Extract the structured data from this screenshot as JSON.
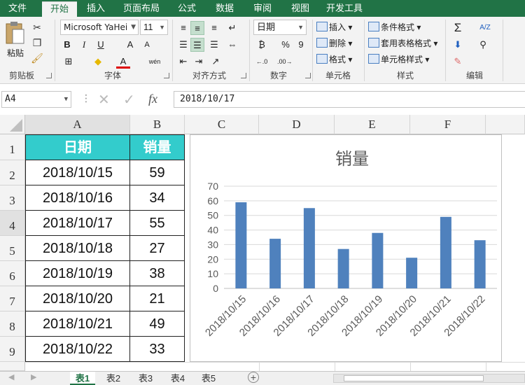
{
  "tabs": [
    "文件",
    "开始",
    "插入",
    "页面布局",
    "公式",
    "数据",
    "审阅",
    "视图",
    "开发工具"
  ],
  "active_tab": "开始",
  "ribbon": {
    "clipboard": {
      "paste": "粘贴",
      "label": "剪贴板"
    },
    "font": {
      "family": "Microsoft YaHei",
      "size": "11",
      "bold": "B",
      "italic": "I",
      "underline": "U",
      "grow": "A",
      "shrink": "A",
      "phonetic": "wén",
      "label": "字体"
    },
    "alignment": {
      "label": "对齐方式"
    },
    "number": {
      "format": "日期",
      "percent": "%",
      "comma": "9",
      "label": "数字"
    },
    "cells": {
      "insert": "插入",
      "delete": "删除",
      "format": "格式",
      "label": "单元格"
    },
    "styles": {
      "conditional": "条件格式",
      "table": "套用表格格式",
      "cell_styles": "单元格样式",
      "label": "样式"
    },
    "editing": {
      "sum": "Σ",
      "sort": "A/Z",
      "label": "编辑"
    }
  },
  "formula_bar": {
    "name_box": "A4",
    "fx": "fx",
    "value": "2018/10/17"
  },
  "columns": [
    "A",
    "B",
    "C",
    "D",
    "E",
    "F"
  ],
  "rows": [
    "1",
    "2",
    "3",
    "4",
    "5",
    "6",
    "7",
    "8",
    "9"
  ],
  "table": {
    "header": [
      "日期",
      "销量"
    ],
    "rows": [
      [
        "2018/10/15",
        "59"
      ],
      [
        "2018/10/16",
        "34"
      ],
      [
        "2018/10/17",
        "55"
      ],
      [
        "2018/10/18",
        "27"
      ],
      [
        "2018/10/19",
        "38"
      ],
      [
        "2018/10/20",
        "21"
      ],
      [
        "2018/10/21",
        "49"
      ],
      [
        "2018/10/22",
        "33"
      ]
    ]
  },
  "colors": {
    "excel_green": "#217346",
    "header_teal": "#33cccc",
    "bar_blue": "#4f81bd"
  },
  "chart_data": {
    "type": "bar",
    "title": "销量",
    "categories": [
      "2018/10/15",
      "2018/10/16",
      "2018/10/17",
      "2018/10/18",
      "2018/10/19",
      "2018/10/20",
      "2018/10/21",
      "2018/10/22"
    ],
    "values": [
      59,
      34,
      55,
      27,
      38,
      21,
      49,
      33
    ],
    "ylim": [
      0,
      70
    ],
    "yticks": [
      "0",
      "10",
      "20",
      "30",
      "40",
      "50",
      "60",
      "70"
    ],
    "grid": true,
    "legend": "none"
  },
  "sheets": [
    "表1",
    "表2",
    "表3",
    "表4",
    "表5"
  ],
  "active_sheet": "表1"
}
